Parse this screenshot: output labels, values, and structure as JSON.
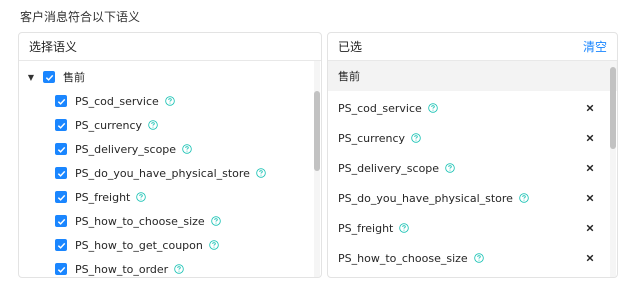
{
  "page": {
    "heading": "客户消息符合以下语义"
  },
  "left_panel": {
    "title": "选择语义",
    "parent": {
      "label": "售前",
      "checked": true,
      "expanded": true
    },
    "items": [
      {
        "label": "PS_cod_service",
        "checked": true
      },
      {
        "label": "PS_currency",
        "checked": true
      },
      {
        "label": "PS_delivery_scope",
        "checked": true
      },
      {
        "label": "PS_do_you_have_physical_store",
        "checked": true
      },
      {
        "label": "PS_freight",
        "checked": true
      },
      {
        "label": "PS_how_to_choose_size",
        "checked": true
      },
      {
        "label": "PS_how_to_get_coupon",
        "checked": true
      },
      {
        "label": "PS_how_to_order",
        "checked": true
      }
    ]
  },
  "right_panel": {
    "title": "已选",
    "clear_label": "清空",
    "group_label": "售前",
    "items": [
      {
        "label": "PS_cod_service"
      },
      {
        "label": "PS_currency"
      },
      {
        "label": "PS_delivery_scope"
      },
      {
        "label": "PS_do_you_have_physical_store"
      },
      {
        "label": "PS_freight"
      },
      {
        "label": "PS_how_to_choose_size"
      }
    ]
  },
  "colors": {
    "accent": "#1a86ff",
    "help_icon": "#18c2b4"
  }
}
